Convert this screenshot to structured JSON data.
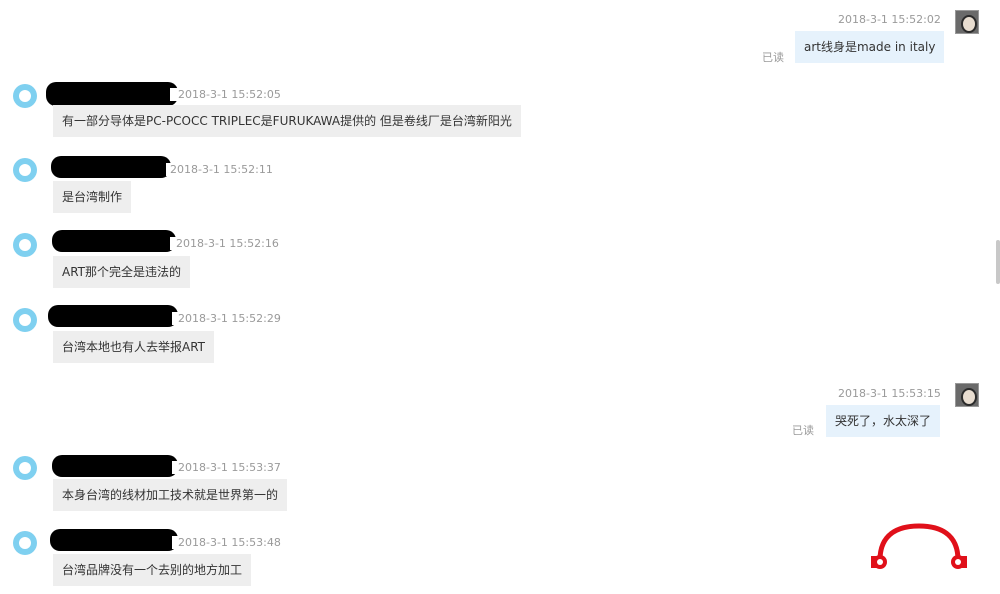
{
  "messages": [
    {
      "dir": "out",
      "ts": "2018-3-1 15:52:02",
      "text": "art线身是made in italy",
      "read": "已读"
    },
    {
      "dir": "in",
      "ts": "2018-3-1 15:52:05",
      "text": "有一部分导体是PC-PCOCC TRIPLEC是FURUKAWA提供的 但是卷线厂是台湾新阳光"
    },
    {
      "dir": "in",
      "ts": "2018-3-1 15:52:11",
      "text": "是台湾制作"
    },
    {
      "dir": "in",
      "ts": "2018-3-1 15:52:16",
      "text": "ART那个完全是违法的"
    },
    {
      "dir": "in",
      "ts": "2018-3-1 15:52:29",
      "text": "台湾本地也有人去举报ART"
    },
    {
      "dir": "out",
      "ts": "2018-3-1 15:53:15",
      "text": "哭死了，水太深了",
      "read": "已读"
    },
    {
      "dir": "in",
      "ts": "2018-3-1 15:53:37",
      "text": "本身台湾的线材加工技术就是世界第一的"
    },
    {
      "dir": "in",
      "ts": "2018-3-1 15:53:48",
      "text": "台湾品牌没有一个去别的地方加工"
    }
  ],
  "colors": {
    "incoming_bubble": "#eeeeee",
    "outgoing_bubble": "#e6f2fc",
    "timestamp": "#9a9a9a",
    "avatar_in": "#7fd0f0",
    "logo": "#e0101a"
  },
  "icons": {
    "incoming_avatar": "avatar-default-icon",
    "outgoing_avatar": "user-photo-avatar",
    "watermark": "headphone-logo-icon"
  }
}
